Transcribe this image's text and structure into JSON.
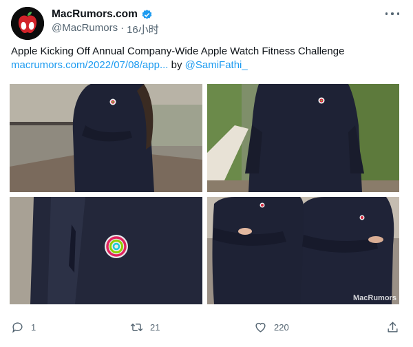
{
  "author": {
    "display_name": "MacRumors.com",
    "handle": "@MacRumors",
    "separator": "·",
    "time": "16小时",
    "verified": true,
    "avatar_icon": "macrumors-apple-logo"
  },
  "tweet": {
    "headline": "Apple Kicking Off Annual Company-Wide Apple Watch Fitness Challenge",
    "link_text": "macrumors.com/2022/07/08/app...",
    "by_text": "by",
    "mention": "@SamiFathi_"
  },
  "media": {
    "watermark": "MacRumors"
  },
  "actions": {
    "reply_count": "1",
    "retweet_count": "21",
    "like_count": "220"
  },
  "colors": {
    "link": "#1d9bf0",
    "text": "#0f1419",
    "secondary": "#536471",
    "verified": "#1d9bf0",
    "shirt": "#1e2235"
  }
}
